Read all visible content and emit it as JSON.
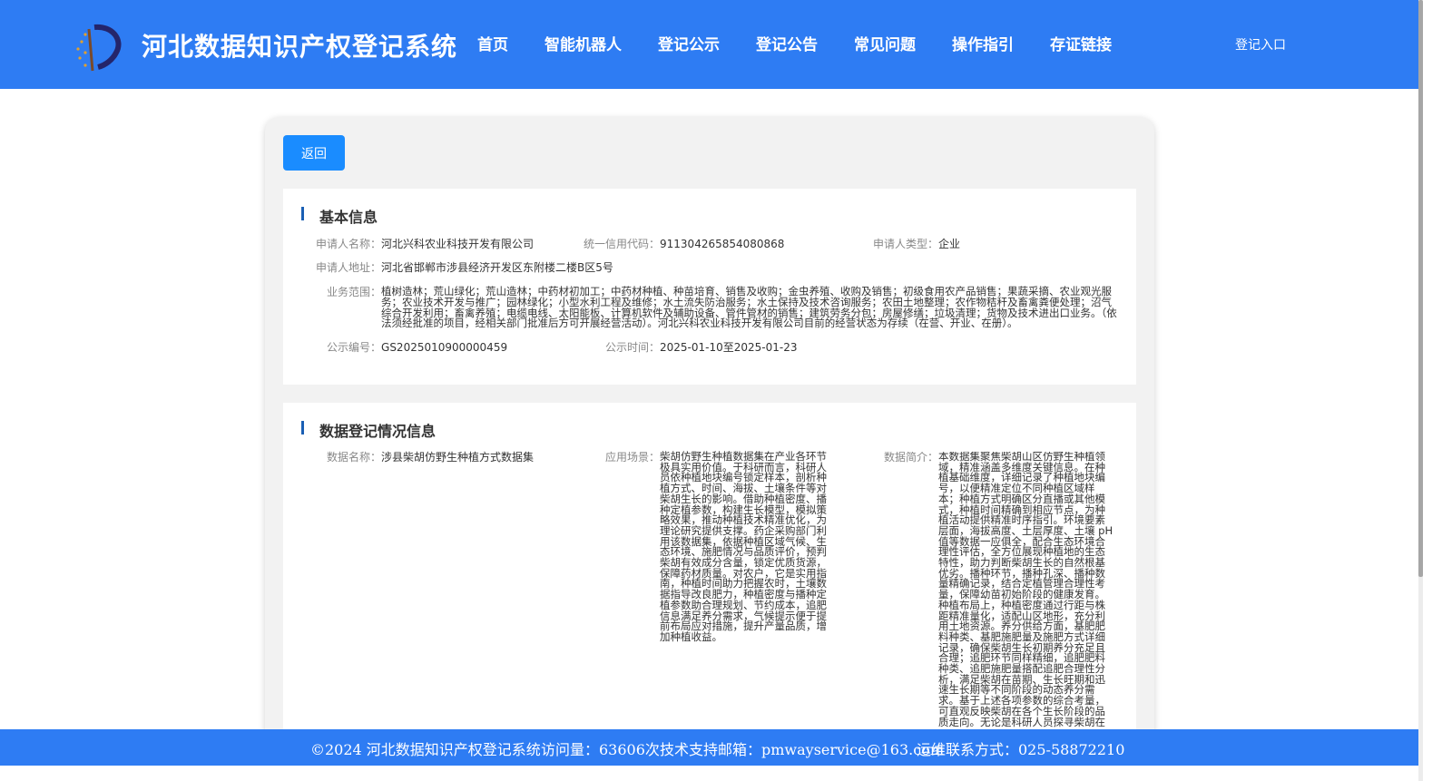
{
  "header": {
    "title": "河北数据知识产权登记系统",
    "nav": [
      "首页",
      "智能机器人",
      "登记公示",
      "登记公告",
      "常见问题",
      "操作指引",
      "存证链接"
    ],
    "login": "登记入口"
  },
  "back_label": "返回",
  "basic": {
    "title": "基本信息",
    "applicant_name_label": "申请人名称：",
    "applicant_name": "河北兴科农业科技开发有限公司",
    "credit_code_label": "统一信用代码：",
    "credit_code": "911304265854080868",
    "applicant_type_label": "申请人类型：",
    "applicant_type": "企业",
    "address_label": "申请人地址：",
    "address": "河北省邯郸市涉县经济开发区东附楼二楼B区5号",
    "scope_label": "业务范围：",
    "scope": "植树造林；荒山绿化；荒山造林；中药材初加工；中药材种植、种苗培育、销售及收购；金虫养殖、收购及销售；初级食用农产品销售；果蔬采摘、农业观光服务；农业技术开发与推广；园林绿化；小型水利工程及维修；水土流失防治服务；水土保持及技术咨询服务；农田土地整理；农作物秸秆及畜禽粪便处理；沼气综合开发利用；畜禽养殖；电缆电线、太阳能板、计算机软件及辅助设备、管件管材的销售；建筑劳务分包；房屋修缮；垃圾清理；货物及技术进出口业务。（依法须经批准的项目，经相关部门批准后方可开展经营活动）。河北兴科农业科技开发有限公司目前的经营状态为存续（在营、开业、在册）。",
    "pub_no_label": "公示编号：",
    "pub_no": "GS2025010900000459",
    "pub_time_label": "公示时间：",
    "pub_time": "2025-01-10至2025-01-23"
  },
  "data_reg": {
    "title": "数据登记情况信息",
    "name_label": "数据名称：",
    "name": "涉县柴胡仿野生种植方式数据集",
    "scene_label": "应用场景：",
    "scene": "柴胡仿野生种植数据集在产业各环节极具实用价值。于科研而言，科研人员依种植地块编号锁定样本，剖析种植方式、时间、海拔、土壤条件等对柴胡生长的影响。借助种植密度、播种定植参数，构建生长模型，模拟策略效果，推动种植技术精准优化，为理论研究提供支撑。药企采购部门利用该数据集，依据种植区域气候、生态环境、施肥情况与品质评价，预判柴胡有效成分含量，锁定优质货源，保障药材质量。对农户，它是实用指南，种植时间助力把握农时，土壤数据指导改良肥力，种植密度与播种定植参数助合理规划、节约成本，追肥信息满足养分需求，气候提示便于提前布局应对措施，提升产量品质，增加种植收益。",
    "intro_label": "数据简介：",
    "intro": "本数据集聚焦柴胡山区仿野生种植领域，精准涵盖多维度关键信息。在种植基础维度，详细记录了种植地块编号，以便精准定位不同种植区域样本；种植方式明确区分直播或其他模式，种植时间精确到相应节点，为种植活动提供精准时序指引。环境要素层面，海拔高度、土层厚度、土壤 pH 值等数据一应俱全，配合生态环境合理性评估，全方位展现种植地的生态特性，助力判断柴胡生长的自然根基优劣。播种环节，播种孔深、播种数量精确记录，结合定植管理合理性考量，保障幼苗初始阶段的健康发育。种植布局上，种植密度通过行距与株距精准量化，适配山区地形，充分利用土地资源。养分供给方面，基肥肥料种类、基肥施肥量及施肥方式详细记录，确保柴胡生长初期养分充足且合理；追肥环节同样精细，追肥肥料种类、追肥施肥量搭配追肥合理性分析，满足柴胡在苗期、生长旺期和迅速生长期等不同阶段的动态养分需求。基于上述各项参数的综合考量，可直观反映柴胡在各个生长阶段的品质走向。无论是科研人员探寻柴胡在"
  },
  "footer": {
    "copyright": "©2024 河北数据知识产权登记系统",
    "visits": "访问量：63606次",
    "support": "技术支持邮箱：pmwayservice@163.com",
    "ops": "运维联系方式：025-58872210"
  },
  "colors": {
    "brand_blue": "#2e7cf3",
    "button_blue": "#1a8cff",
    "card_bg": "#f2f2f2"
  }
}
